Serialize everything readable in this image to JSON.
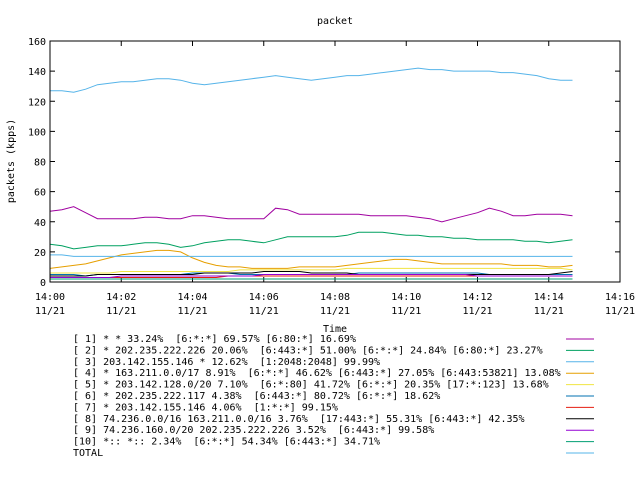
{
  "chart_data": {
    "type": "line",
    "title": "packet",
    "xlabel": "Time",
    "ylabel": "packets (kpps)",
    "xlim": [
      "14:00",
      "14:16"
    ],
    "ylim": [
      0,
      160
    ],
    "yticks": [
      0,
      20,
      40,
      60,
      80,
      100,
      120,
      140,
      160
    ],
    "xticks": [
      {
        "time": "14:00",
        "date": "11/21"
      },
      {
        "time": "14:02",
        "date": "11/21"
      },
      {
        "time": "14:04",
        "date": "11/21"
      },
      {
        "time": "14:06",
        "date": "11/21"
      },
      {
        "time": "14:08",
        "date": "11/21"
      },
      {
        "time": "14:10",
        "date": "11/21"
      },
      {
        "time": "14:12",
        "date": "11/21"
      },
      {
        "time": "14:14",
        "date": "11/21"
      },
      {
        "time": "14:16",
        "date": "11/21"
      }
    ],
    "grid": false,
    "legend_position": "bottom",
    "x": [
      "14:00:00",
      "14:00:20",
      "14:00:40",
      "14:01:00",
      "14:01:20",
      "14:01:40",
      "14:02:00",
      "14:02:20",
      "14:02:40",
      "14:03:00",
      "14:03:20",
      "14:03:40",
      "14:04:00",
      "14:04:20",
      "14:04:40",
      "14:05:00",
      "14:05:20",
      "14:05:40",
      "14:06:00",
      "14:06:20",
      "14:06:40",
      "14:07:00",
      "14:07:20",
      "14:07:40",
      "14:08:00",
      "14:08:20",
      "14:08:40",
      "14:09:00",
      "14:09:20",
      "14:09:40",
      "14:10:00",
      "14:10:20",
      "14:10:40",
      "14:11:00",
      "14:11:20",
      "14:11:40",
      "14:12:00",
      "14:12:20",
      "14:12:40",
      "14:13:00",
      "14:13:20",
      "14:13:40",
      "14:14:00",
      "14:14:20",
      "14:14:40"
    ],
    "series": [
      {
        "name": "[ 1] * * 33.24%  [6:*:*] 69.57% [6:80:*] 16.69%",
        "color": "#a000a0",
        "values": [
          47,
          48,
          50,
          46,
          42,
          42,
          42,
          42,
          43,
          43,
          42,
          42,
          44,
          44,
          43,
          42,
          42,
          42,
          42,
          49,
          48,
          45,
          45,
          45,
          45,
          45,
          45,
          44,
          44,
          44,
          44,
          43,
          42,
          40,
          42,
          44,
          46,
          49,
          47,
          44,
          44,
          45,
          45,
          45,
          44
        ]
      },
      {
        "name": "[ 2] * 202.235.222.226 20.06%  [6:443:*] 51.00% [6:*:*] 24.84% [6:80:*] 23.27%",
        "color": "#00a060",
        "values": [
          25,
          24,
          22,
          23,
          24,
          24,
          24,
          25,
          26,
          26,
          25,
          23,
          24,
          26,
          27,
          28,
          28,
          27,
          26,
          28,
          30,
          30,
          30,
          30,
          30,
          31,
          33,
          33,
          33,
          32,
          31,
          31,
          30,
          30,
          29,
          29,
          28,
          28,
          28,
          28,
          27,
          27,
          26,
          27,
          28
        ]
      },
      {
        "name": "[ 3] 203.142.155.146 * 12.62%  [1:2048:2048] 99.99%",
        "color": "#56b4e9",
        "values": [
          127,
          127,
          126,
          128,
          131,
          132,
          133,
          133,
          134,
          135,
          135,
          134,
          132,
          131,
          132,
          133,
          134,
          135,
          136,
          137,
          136,
          135,
          134,
          135,
          136,
          137,
          137,
          138,
          139,
          140,
          141,
          142,
          141,
          141,
          140,
          140,
          140,
          140,
          139,
          139,
          138,
          137,
          135,
          134,
          134
        ]
      },
      {
        "name": "[ 4] * 163.211.0.0/17 8.91%  [6:*:*] 46.62% [6:443:*] 27.05% [6:443:53821] 13.08%",
        "color": "#e69f00",
        "values": [
          9,
          10,
          11,
          12,
          14,
          16,
          18,
          19,
          20,
          21,
          21,
          20,
          16,
          13,
          11,
          10,
          10,
          9,
          9,
          9,
          9,
          10,
          10,
          10,
          10,
          11,
          12,
          13,
          14,
          15,
          15,
          14,
          13,
          12,
          12,
          12,
          12,
          12,
          12,
          11,
          11,
          11,
          10,
          10,
          11
        ]
      },
      {
        "name": "[ 5] * 203.142.128.0/20 7.10%  [6:*:80] 41.72% [6:*:*] 20.35% [17:*:123] 13.68%",
        "color": "#f0e442",
        "values": [
          6,
          6,
          6,
          6,
          6,
          6,
          7,
          7,
          7,
          7,
          7,
          7,
          7,
          7,
          7,
          7,
          8,
          8,
          8,
          8,
          8,
          8,
          8,
          8,
          8,
          9,
          9,
          9,
          9,
          9,
          9,
          9,
          9,
          9,
          9,
          9,
          9,
          9,
          9,
          9,
          9,
          9,
          9,
          9,
          8
        ]
      },
      {
        "name": "[ 6] * 202.235.222.117 4.38%  [6:443:*] 80.72% [6:*:*] 18.62%",
        "color": "#0072b2",
        "values": [
          5,
          5,
          5,
          4,
          5,
          5,
          5,
          5,
          5,
          5,
          5,
          5,
          6,
          6,
          6,
          6,
          5,
          5,
          5,
          5,
          5,
          5,
          5,
          5,
          5,
          5,
          6,
          6,
          6,
          6,
          6,
          6,
          6,
          6,
          6,
          6,
          6,
          5,
          5,
          5,
          5,
          5,
          5,
          5,
          5
        ]
      },
      {
        "name": "[ 7] * 203.142.155.146 4.06%  [1:*:*] 99.15%",
        "color": "#e51e10",
        "values": [
          3,
          3,
          3,
          3,
          3,
          3,
          3,
          3,
          3,
          3,
          3,
          3,
          3,
          3,
          3,
          4,
          4,
          4,
          4,
          4,
          4,
          4,
          4,
          4,
          4,
          4,
          4,
          4,
          4,
          4,
          4,
          4,
          4,
          4,
          4,
          4,
          4,
          4,
          4,
          4,
          4,
          4,
          4,
          4,
          4
        ]
      },
      {
        "name": "[ 8] 74.236.0.0/16 163.211.0.0/16 3.76%  [17:443:*] 55.31% [6:443:*] 42.35%",
        "color": "#000000",
        "values": [
          4,
          4,
          4,
          4,
          5,
          5,
          5,
          5,
          5,
          5,
          5,
          5,
          5,
          6,
          6,
          6,
          6,
          6,
          7,
          7,
          7,
          7,
          6,
          6,
          6,
          6,
          5,
          5,
          5,
          5,
          5,
          5,
          5,
          5,
          5,
          5,
          5,
          5,
          5,
          5,
          5,
          5,
          5,
          6,
          7
        ]
      },
      {
        "name": "[ 9] 74.236.160.0/20 202.235.222.226 3.52%  [6:443:*] 99.58%",
        "color": "#9400d3",
        "values": [
          3,
          3,
          3,
          3,
          3,
          3,
          4,
          4,
          4,
          4,
          4,
          4,
          4,
          4,
          4,
          4,
          4,
          4,
          5,
          5,
          5,
          5,
          5,
          5,
          5,
          5,
          5,
          5,
          5,
          5,
          5,
          5,
          5,
          5,
          5,
          5,
          4,
          4,
          4,
          4,
          4,
          4,
          4,
          4,
          4
        ]
      },
      {
        "name": "[10] *:: *:: 2.34%  [6:*:*] 54.34% [6:443:*] 34.71%",
        "color": "#009e73",
        "values": [
          2,
          2,
          2,
          2,
          2,
          2,
          2,
          2,
          2,
          2,
          2,
          2,
          2,
          2,
          2,
          2,
          2,
          2,
          2,
          2,
          2,
          2,
          2,
          2,
          2,
          2,
          2,
          2,
          2,
          2,
          2,
          2,
          2,
          2,
          2,
          2,
          2,
          2,
          2,
          2,
          2,
          2,
          2,
          2,
          2
        ]
      },
      {
        "name": "TOTAL",
        "color": "#56b4e9",
        "values": [
          18,
          18,
          17,
          17,
          17,
          17,
          17,
          17,
          17,
          17,
          17,
          17,
          17,
          17,
          17,
          17,
          17,
          17,
          17,
          17,
          17,
          17,
          17,
          17,
          17,
          17,
          17,
          17,
          17,
          17,
          17,
          17,
          17,
          17,
          17,
          17,
          17,
          17,
          17,
          17,
          17,
          17,
          17,
          17,
          17
        ]
      }
    ]
  }
}
